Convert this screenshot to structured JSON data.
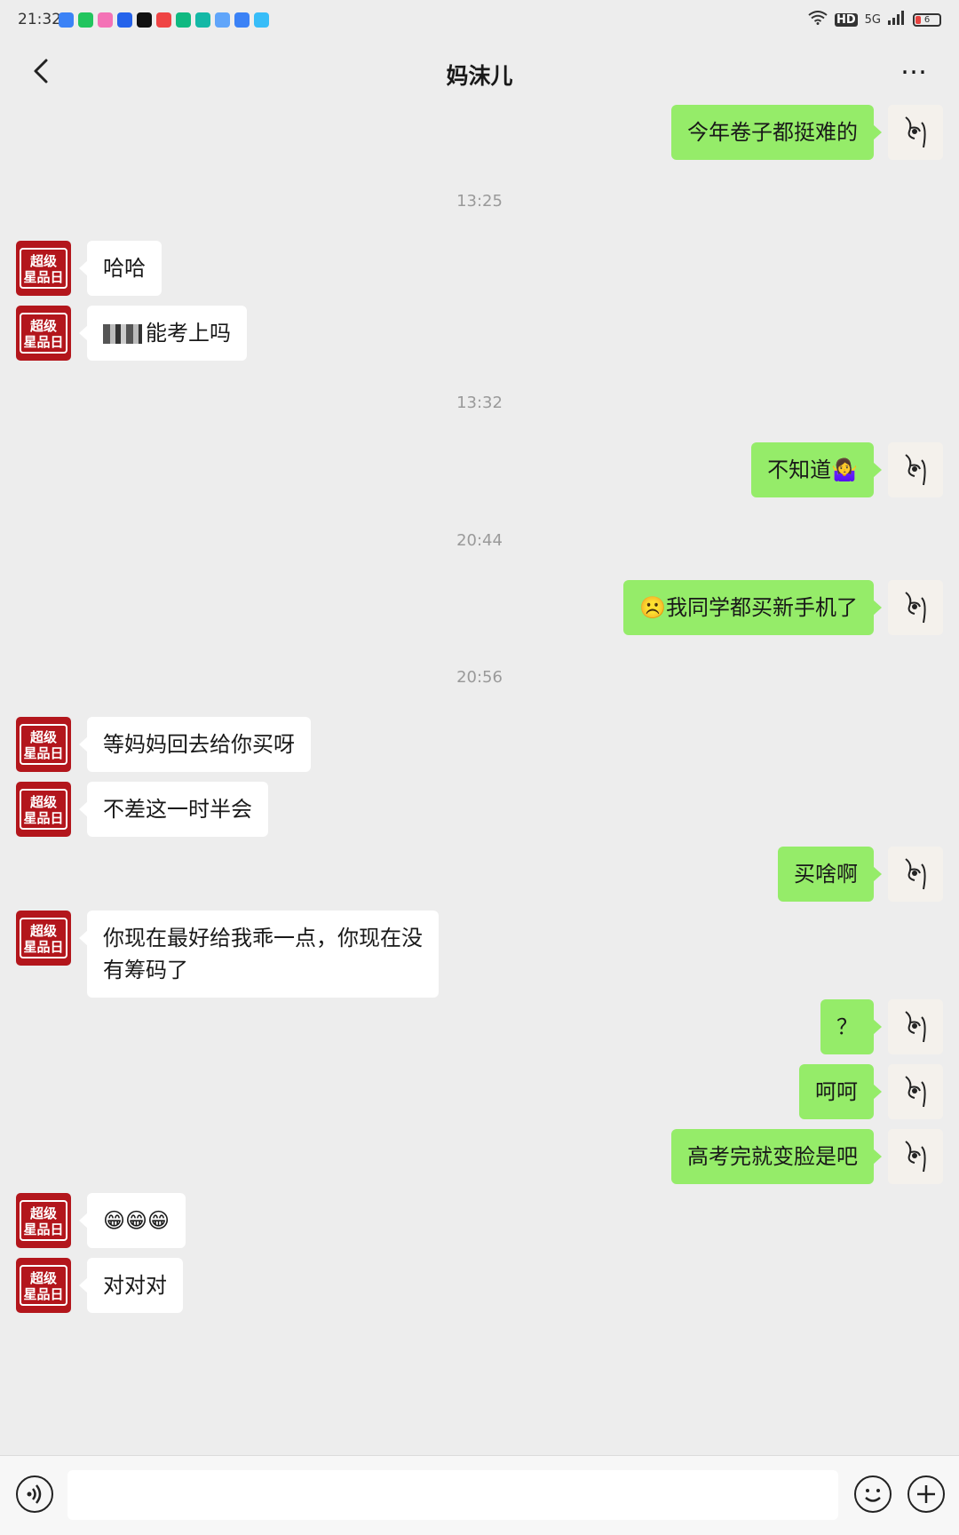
{
  "status_bar": {
    "time": "21:32",
    "network": "5G",
    "hd": "HD",
    "battery": "6",
    "app_icon_colors": [
      "#3b82f6",
      "#22c55e",
      "#f472b6",
      "#2563eb",
      "#111111",
      "#ef4444",
      "#10b981",
      "#14b8a6",
      "#60a5fa",
      "#3b82f6",
      "#38bdf8"
    ]
  },
  "nav": {
    "title": "妈沫儿",
    "more_label": "…"
  },
  "colors": {
    "sent_bubble": "#95ec69",
    "received_bubble": "#ffffff",
    "background": "#ededed",
    "avatar_contact": "#b3161c"
  },
  "contact_avatar_text": "超级\n星品日",
  "messages": [
    {
      "type": "msg",
      "side": "right",
      "text": "今年卷子都挺难的"
    },
    {
      "type": "time",
      "text": "13:25"
    },
    {
      "type": "msg",
      "side": "left",
      "text": "哈哈"
    },
    {
      "type": "msg",
      "side": "left",
      "text": "能考上吗",
      "redacted_prefix": true
    },
    {
      "type": "time",
      "text": "13:32"
    },
    {
      "type": "msg",
      "side": "right",
      "text": "不知道🤷‍♀️"
    },
    {
      "type": "time",
      "text": "20:44"
    },
    {
      "type": "msg",
      "side": "right",
      "text": "☹️我同学都买新手机了"
    },
    {
      "type": "time",
      "text": "20:56"
    },
    {
      "type": "msg",
      "side": "left",
      "text": "等妈妈回去给你买呀"
    },
    {
      "type": "msg",
      "side": "left",
      "text": "不差这一时半会"
    },
    {
      "type": "msg",
      "side": "right",
      "text": "买啥啊"
    },
    {
      "type": "msg",
      "side": "left",
      "text": "你现在最好给我乖一点，你现在没\n有筹码了"
    },
    {
      "type": "msg",
      "side": "right",
      "text": "？"
    },
    {
      "type": "msg",
      "side": "right",
      "text": "呵呵"
    },
    {
      "type": "msg",
      "side": "right",
      "text": "高考完就变脸是吧"
    },
    {
      "type": "msg",
      "side": "left",
      "text": "😁😁😁"
    },
    {
      "type": "msg",
      "side": "left",
      "text": "对对对"
    }
  ],
  "input_bar": {
    "voice_icon": "voice-icon",
    "emoji_icon": "emoji-icon",
    "plus_icon": "plus-icon"
  }
}
